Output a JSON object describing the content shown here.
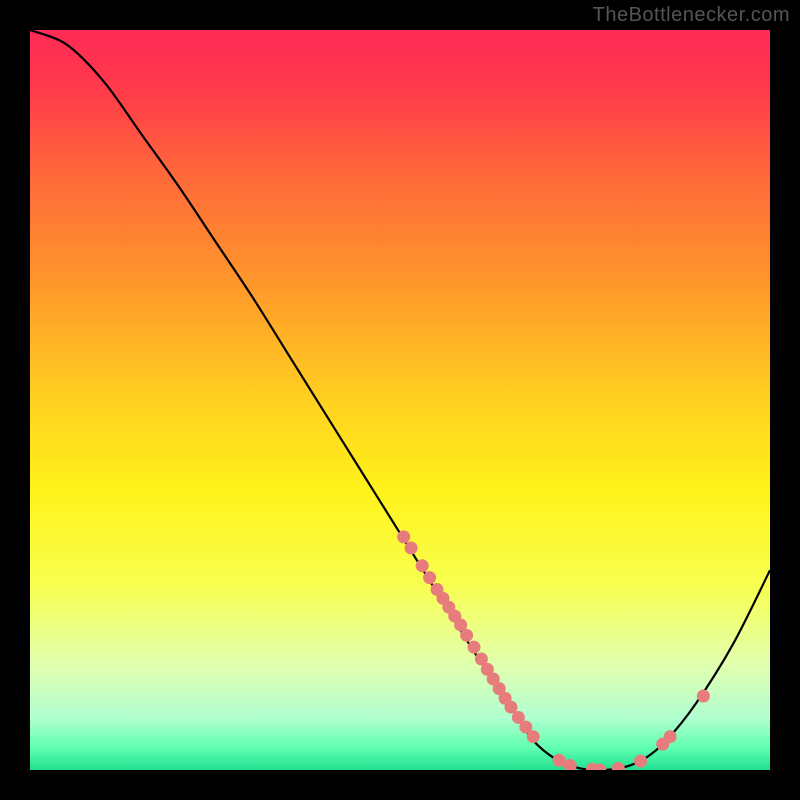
{
  "attribution": "TheBottlenecker.com",
  "chart_data": {
    "type": "line",
    "title": "",
    "xlabel": "",
    "ylabel": "",
    "xlim": [
      0,
      100
    ],
    "ylim": [
      0,
      100
    ],
    "curve": [
      {
        "x": 0,
        "y": 100
      },
      {
        "x": 5,
        "y": 98
      },
      {
        "x": 10,
        "y": 93
      },
      {
        "x": 15,
        "y": 86
      },
      {
        "x": 20,
        "y": 79
      },
      {
        "x": 25,
        "y": 71.5
      },
      {
        "x": 30,
        "y": 64
      },
      {
        "x": 35,
        "y": 56
      },
      {
        "x": 40,
        "y": 48
      },
      {
        "x": 45,
        "y": 40
      },
      {
        "x": 50,
        "y": 32
      },
      {
        "x": 55,
        "y": 24
      },
      {
        "x": 60,
        "y": 16
      },
      {
        "x": 65,
        "y": 8.5
      },
      {
        "x": 68,
        "y": 4
      },
      {
        "x": 71,
        "y": 1.5
      },
      {
        "x": 74,
        "y": 0.3
      },
      {
        "x": 77,
        "y": 0
      },
      {
        "x": 80,
        "y": 0.3
      },
      {
        "x": 83,
        "y": 1.5
      },
      {
        "x": 86,
        "y": 4
      },
      {
        "x": 90,
        "y": 9
      },
      {
        "x": 95,
        "y": 17
      },
      {
        "x": 100,
        "y": 27
      }
    ],
    "scatter": [
      {
        "x": 50.5,
        "y": 31.5
      },
      {
        "x": 51.5,
        "y": 30.0
      },
      {
        "x": 53.0,
        "y": 27.6
      },
      {
        "x": 54.0,
        "y": 26.0
      },
      {
        "x": 55.0,
        "y": 24.4
      },
      {
        "x": 55.8,
        "y": 23.2
      },
      {
        "x": 56.6,
        "y": 22.0
      },
      {
        "x": 57.4,
        "y": 20.8
      },
      {
        "x": 58.2,
        "y": 19.6
      },
      {
        "x": 59.0,
        "y": 18.2
      },
      {
        "x": 60.0,
        "y": 16.6
      },
      {
        "x": 61.0,
        "y": 15.0
      },
      {
        "x": 61.8,
        "y": 13.6
      },
      {
        "x": 62.6,
        "y": 12.3
      },
      {
        "x": 63.4,
        "y": 11.0
      },
      {
        "x": 64.2,
        "y": 9.7
      },
      {
        "x": 65.0,
        "y": 8.5
      },
      {
        "x": 66.0,
        "y": 7.1
      },
      {
        "x": 67.0,
        "y": 5.8
      },
      {
        "x": 68.0,
        "y": 4.5
      },
      {
        "x": 71.5,
        "y": 1.3
      },
      {
        "x": 73.0,
        "y": 0.6
      },
      {
        "x": 76.0,
        "y": 0.1
      },
      {
        "x": 77.0,
        "y": 0.0
      },
      {
        "x": 79.5,
        "y": 0.2
      },
      {
        "x": 82.5,
        "y": 1.2
      },
      {
        "x": 85.5,
        "y": 3.5
      },
      {
        "x": 86.5,
        "y": 4.5
      },
      {
        "x": 91.0,
        "y": 10.0
      }
    ],
    "gradient_stops": [
      {
        "offset": 0,
        "color": "#ff2a55"
      },
      {
        "offset": 0.08,
        "color": "#ff3a4a"
      },
      {
        "offset": 0.2,
        "color": "#ff6a3a"
      },
      {
        "offset": 0.35,
        "color": "#ff9a2a"
      },
      {
        "offset": 0.5,
        "color": "#ffd020"
      },
      {
        "offset": 0.62,
        "color": "#fff21a"
      },
      {
        "offset": 0.75,
        "color": "#f8ff50"
      },
      {
        "offset": 0.86,
        "color": "#e0ffb0"
      },
      {
        "offset": 0.93,
        "color": "#b0ffd0"
      },
      {
        "offset": 0.97,
        "color": "#60ffb0"
      },
      {
        "offset": 1.0,
        "color": "#20e090"
      }
    ],
    "marker_color": "#e77c7c",
    "line_color": "#000000"
  }
}
